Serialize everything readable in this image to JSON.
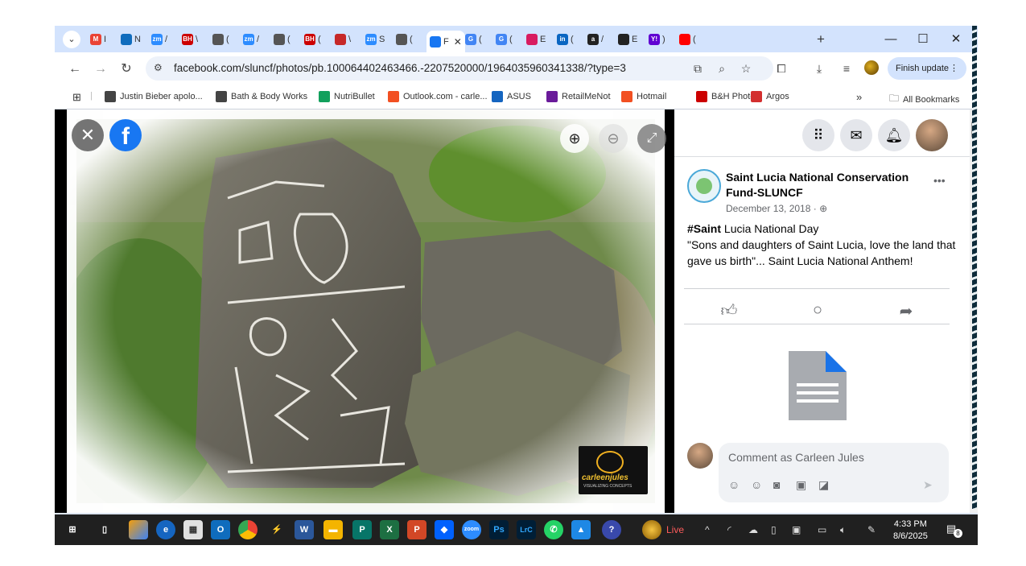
{
  "browser": {
    "tabs": [
      {
        "icon": "gmail-icon",
        "label": "M",
        "letter": "I",
        "color": "#ea4335"
      },
      {
        "icon": "outlook-icon",
        "label": "",
        "letter": "N",
        "color": "#0f6cbd"
      },
      {
        "icon": "zoom-icon",
        "label": "zm",
        "letter": "/",
        "color": "#2d8cff"
      },
      {
        "icon": "bh-icon",
        "label": "BH",
        "letter": "\\",
        "color": "#cc0000"
      },
      {
        "icon": "globe-icon",
        "label": "",
        "letter": "(",
        "color": "#555555"
      },
      {
        "icon": "zoom-icon",
        "label": "zm",
        "letter": "/",
        "color": "#2d8cff"
      },
      {
        "icon": "globe-icon",
        "label": "",
        "letter": "(",
        "color": "#555555"
      },
      {
        "icon": "bh-icon",
        "label": "BH",
        "letter": "(",
        "color": "#cc0000"
      },
      {
        "icon": "red-square-icon",
        "label": "",
        "letter": "\\",
        "color": "#c62828"
      },
      {
        "icon": "zoom-icon",
        "label": "zm",
        "letter": "S",
        "color": "#2d8cff"
      },
      {
        "icon": "globe-icon",
        "label": "",
        "letter": "(",
        "color": "#555555"
      },
      {
        "icon": "facebook-icon",
        "label": "",
        "letter": "F",
        "color": "#1877f2"
      },
      {
        "icon": "google-icon",
        "label": "G",
        "letter": "(",
        "color": "#4285f4"
      },
      {
        "icon": "google-icon",
        "label": "G",
        "letter": "(",
        "color": "#4285f4"
      },
      {
        "icon": "diamond-icon",
        "label": "",
        "letter": "E",
        "color": "#d81b60"
      },
      {
        "icon": "linkedin-icon",
        "label": "in",
        "letter": "(",
        "color": "#0a66c2"
      },
      {
        "icon": "amazon-icon",
        "label": "a",
        "letter": "/",
        "color": "#222222"
      },
      {
        "icon": "dji-icon",
        "label": "",
        "letter": "E",
        "color": "#222222"
      },
      {
        "icon": "yahoo-icon",
        "label": "Y!",
        "letter": ")",
        "color": "#6001d2"
      },
      {
        "icon": "youtube-icon",
        "label": "",
        "letter": "(",
        "color": "#ff0000"
      }
    ],
    "new_tab": "+",
    "window": {
      "minimize": "—",
      "maximize": "☐",
      "close": "✕"
    },
    "url": "facebook.com/sluncf/photos/pb.100064402463466.-2207520000/1964035960341338/?type=3",
    "finish_update": "Finish update",
    "bookmarks": [
      {
        "label": "Justin Bieber apolo...",
        "icon": "globe-icon",
        "color": "#444444"
      },
      {
        "label": "Bath & Body Works",
        "icon": "globe-icon",
        "color": "#444444"
      },
      {
        "label": "NutriBullet",
        "icon": "nutribullet-icon",
        "color": "#12a05c"
      },
      {
        "label": "Outlook.com - carle...",
        "icon": "microsoft-icon",
        "color": "#f25022"
      },
      {
        "label": "ASUS",
        "icon": "asus-icon",
        "color": "#1565c0"
      },
      {
        "label": "RetailMeNot",
        "icon": "retailmenot-icon",
        "color": "#6a1b9a"
      },
      {
        "label": "Hotmail",
        "icon": "microsoft-icon",
        "color": "#f25022"
      },
      {
        "label": "B&H Photo",
        "icon": "bh-icon",
        "color": "#cc0000"
      },
      {
        "label": "Argos",
        "icon": "argos-icon",
        "color": "#d32f2f"
      }
    ],
    "more_bookmarks": "»",
    "all_bookmarks": "All Bookmarks"
  },
  "viewer": {
    "watermark": "carleenjules",
    "watermark_sub": "VISUALIZING CONCEPTS"
  },
  "post": {
    "page_name": "Saint Lucia National Conservation Fund-SLUNCF",
    "date": "December 13, 2018 ·",
    "hashtag": "#Saint",
    "line1_rest": " Lucia National Day",
    "line2": "\"Sons and daughters of Saint Lucia, love the land that gave us birth\"... Saint Lucia National Anthem!",
    "more": "•••",
    "comment_placeholder": "Comment as Carleen Jules"
  },
  "taskbar": {
    "live": "Live",
    "time": "4:33 PM",
    "date": "8/6/2025",
    "notif_count": "8"
  }
}
